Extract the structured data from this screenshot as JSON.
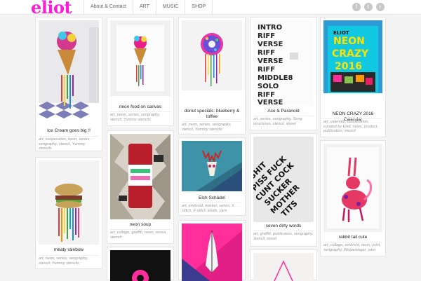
{
  "header": {
    "logo": "eliot",
    "nav": [
      "About & Contact",
      "ART",
      "MUSIC",
      "SHOP"
    ],
    "social_icons": [
      "facebook-icon",
      "twitter-icon",
      "rss-icon"
    ],
    "social_glyphs": [
      "f",
      "t",
      "r"
    ]
  },
  "colors": {
    "logo": "#ff19d9",
    "background": "#f4f4f4"
  },
  "posts": [
    {
      "title": "Ice Cream goes big !!",
      "tags": "art, cooperation, neon, series, serigraphy, stencil, Yummy stencils"
    },
    {
      "title": "meaty rainbow",
      "tags": "art, neon, series, serigraphy, stencil, Yummy stencils"
    },
    {
      "title": "neon food on canvas",
      "tags": "art, news, series, serigraphy, stencil, Yummy stencils"
    },
    {
      "title": "neon soup",
      "tags": "art, collage, graffiti, neon, series, stencil"
    },
    {
      "title": "donut specials: blueberry & toffee",
      "tags": "art, neon, series, serigraphy, stencil, Yummy stencils"
    },
    {
      "title": "Elch Schädel",
      "tags": "art, embroid, marker, series, X stitch, X-stitch skulls, yarn"
    },
    {
      "title": "Ace & Paranoid",
      "tags": "art, series, serigraphy, Song structures, stencil, street"
    },
    {
      "title": "seven dirty words",
      "tags": "art, graffiti, publication, serigraphy, stencil, street"
    },
    {
      "title": "NEON CRAZY 2016 Calendar",
      "tags": "art, calendar, cooperation, curated by Eliot, news, product, publication, stencil"
    },
    {
      "title": "rabbit tail cute",
      "tags": "art, collage, embroid, neon, print, serigraphy, Wolpertinger, yarn"
    }
  ]
}
